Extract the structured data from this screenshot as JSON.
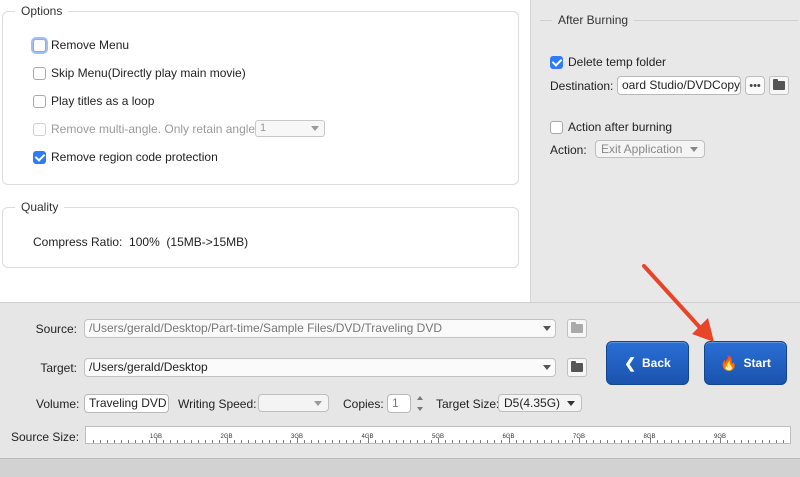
{
  "options": {
    "title": "Options",
    "items": [
      {
        "label": "Remove Menu",
        "checked": false,
        "focused": true,
        "enabled": true
      },
      {
        "label": "Skip Menu(Directly play main movie)",
        "checked": false,
        "enabled": true
      },
      {
        "label": "Play titles as a loop",
        "checked": false,
        "enabled": true
      },
      {
        "label": "Remove multi-angle. Only retain angle",
        "checked": false,
        "enabled": false
      },
      {
        "label": "Remove region code protection",
        "checked": true,
        "enabled": true
      }
    ],
    "angle_value": "1"
  },
  "quality": {
    "title": "Quality",
    "compress_label": "Compress Ratio:",
    "compress_value": "100%",
    "compress_detail": "(15MB->15MB)"
  },
  "after_burning": {
    "title": "After Burning",
    "delete_temp_label": "Delete temp folder",
    "delete_temp_checked": true,
    "destination_label": "Destination:",
    "destination_value": "oard Studio/DVDCopy",
    "dots_label": "•••",
    "action_after_label": "Action after burning",
    "action_after_checked": false,
    "action_label": "Action:",
    "action_value": "Exit Application"
  },
  "bottom": {
    "source_label": "Source:",
    "source_value": "/Users/gerald/Desktop/Part-time/Sample Files/DVD/Traveling DVD",
    "target_label": "Target:",
    "target_value": "/Users/gerald/Desktop",
    "volume_label": "Volume:",
    "volume_value": "Traveling DVD",
    "writing_speed_label": "Writing Speed:",
    "writing_speed_value": "",
    "copies_label": "Copies:",
    "copies_value": "1",
    "target_size_label": "Target Size:",
    "target_size_value": "D5(4.35G)",
    "source_size_label": "Source Size:",
    "size_ticks": [
      "1GB",
      "2GB",
      "3GB",
      "4GB",
      "5GB",
      "6GB",
      "7GB",
      "8GB",
      "9GB"
    ]
  },
  "buttons": {
    "back_label": "Back",
    "start_label": "Start"
  },
  "colors": {
    "accent": "#2f7bf6",
    "button_blue": "#1f5fc2",
    "annotation_arrow": "#e8442a"
  }
}
